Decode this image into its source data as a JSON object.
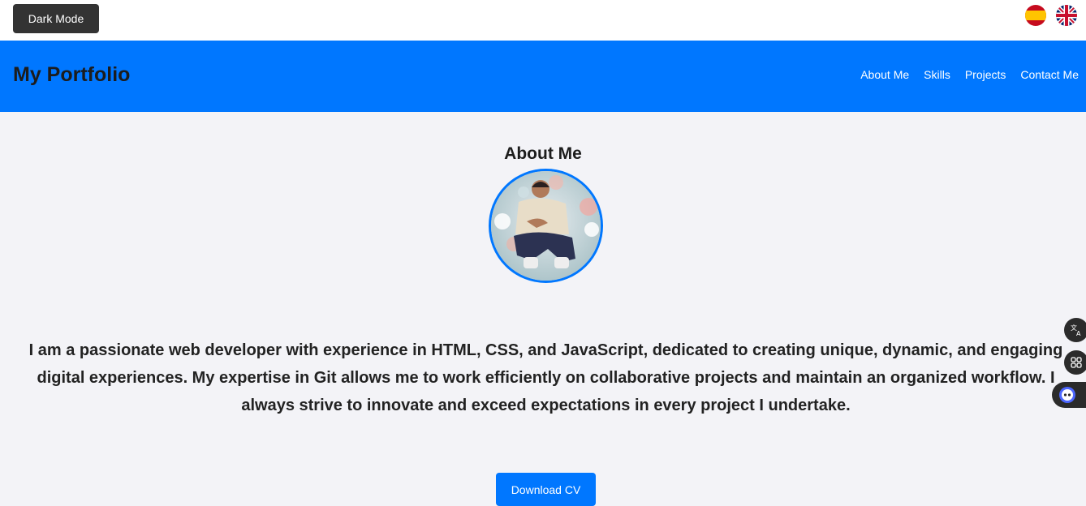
{
  "topbar": {
    "dark_mode_label": "Dark Mode",
    "flags": [
      {
        "name": "spanish-flag-icon"
      },
      {
        "name": "uk-flag-icon"
      }
    ]
  },
  "header": {
    "brand": "My Portfolio",
    "nav": [
      "About Me",
      "Skills",
      "Projects",
      "Contact Me"
    ]
  },
  "about": {
    "title": "About Me",
    "bio": "I am a passionate web developer with experience in HTML, CSS, and JavaScript, dedicated to creating unique, dynamic, and engaging digital experiences. My expertise in Git allows me to work efficiently on collaborative projects and maintain an organized workflow. I always strive to innovate and exceed expectations in every project I undertake.",
    "download_label": "Download CV"
  },
  "colors": {
    "accent": "#0077ff",
    "topbar_button": "#333333",
    "background": "#f3f3f7"
  }
}
